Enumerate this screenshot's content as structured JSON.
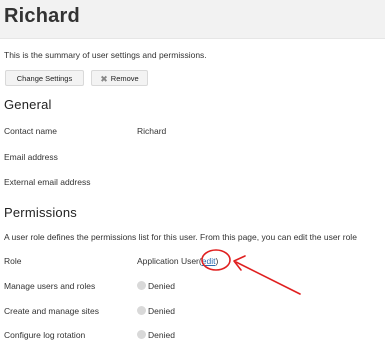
{
  "header": {
    "title": "Richard"
  },
  "summary": "This is the summary of user settings and permissions.",
  "toolbar": {
    "change_label": "Change Settings",
    "remove_label": "Remove"
  },
  "general": {
    "title": "General",
    "rows": [
      {
        "label": "Contact name",
        "value": "Richard"
      },
      {
        "label": "Email address",
        "value": ""
      },
      {
        "label": "External email address",
        "value": ""
      }
    ]
  },
  "permissions": {
    "title": "Permissions",
    "description": "A user role defines the permissions list for this user. From this page, you can edit the user role",
    "role": {
      "label": "Role",
      "value": "Application User",
      "edit_open": "(",
      "edit_label": "edit",
      "edit_close": ")"
    },
    "rows": [
      {
        "label": "Manage users and roles",
        "status": "Denied"
      },
      {
        "label": "Create and manage sites",
        "status": "Denied"
      },
      {
        "label": "Configure log rotation",
        "status": "Denied"
      }
    ]
  },
  "icons": {
    "remove": "close-icon",
    "status": "status-dot-icon"
  },
  "colors": {
    "header_bg": "#f2f2f2",
    "link": "#2b6cb0",
    "annotation": "#e02020",
    "status_dot": "#d9d9d9"
  }
}
